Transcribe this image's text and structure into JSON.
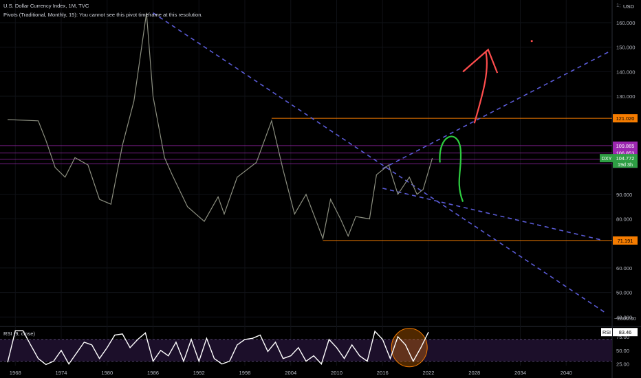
{
  "header": {
    "title": "U.S. Dollar Currency Index, 1M, TVC",
    "pivots_note": "Pivots (Traditional, Monthly, 15): You cannot see this pivot timeframe at this resolution.",
    "currency": "USD",
    "menu_glyph": "1;"
  },
  "rsi_panel": {
    "label": "RSI (9, close)",
    "value_label": "RSI",
    "value": "83.46"
  },
  "chart_data": [
    {
      "type": "line",
      "title": "U.S. Dollar Currency Index, 1M, TVC",
      "symbol": "DXY",
      "x_range": [
        1966,
        2046
      ],
      "y_range": [
        37,
        167
      ],
      "x_ticks": [
        "1968",
        "1974",
        "1980",
        "1986",
        "1992",
        "1998",
        "2004",
        "2010",
        "2016",
        "2022",
        "2028",
        "2034",
        "2040"
      ],
      "y_ticks": [
        "160.000",
        "150.000",
        "140.000",
        "130.000",
        "90.000",
        "80.000",
        "60.000",
        "50.000",
        "40.000"
      ],
      "y_extra_tick": "−2000.00",
      "series_color": "#8c8f80",
      "x": [
        1967,
        1971,
        1972,
        1973.2,
        1974.5,
        1975.8,
        1977.5,
        1979,
        1980.5,
        1982,
        1983.5,
        1985.15,
        1986,
        1987.5,
        1988.5,
        1990.5,
        1992.7,
        1994.5,
        1995.3,
        1997,
        1999.5,
        2001.5,
        2003,
        2004.5,
        2006,
        2008.2,
        2009.2,
        2010.5,
        2011.5,
        2012.5,
        2014.3,
        2015.2,
        2016.8,
        2018,
        2019.5,
        2020.5,
        2021.3,
        2022.5
      ],
      "y": [
        120.5,
        120,
        112,
        101,
        97,
        105,
        102,
        88,
        86,
        110,
        128,
        164,
        130,
        105,
        98,
        85,
        79,
        89,
        82,
        97,
        103,
        120,
        100,
        82,
        90,
        72,
        88,
        80,
        73,
        81,
        80,
        98,
        102,
        90,
        97,
        90,
        92,
        104.772
      ],
      "levels": [
        {
          "label": "109.865",
          "value": 109.865,
          "color": "#9c27b0"
        },
        {
          "label": "106.853",
          "value": 106.853,
          "color": "#9c27b0"
        },
        {
          "label": "104.343",
          "value": 104.343,
          "color": "#9c27b0"
        },
        {
          "label": "102.503",
          "value": 102.503,
          "color": "#9c27b0"
        },
        {
          "label": "121.020",
          "value": 121.02,
          "color": "#f57c00"
        },
        {
          "label": "71.191",
          "value": 71.191,
          "color": "#f57c00"
        }
      ],
      "price_tag": {
        "symbol": "DXY",
        "value": "104.772",
        "countdown": "19d 3h",
        "color": "#2e9e44"
      },
      "trendlines": [
        {
          "x": [
            1986,
            2045
          ],
          "y": [
            164,
            42
          ],
          "style": "dashed",
          "color": "#5a5bd6"
        },
        {
          "x": [
            2016,
            2044.5
          ],
          "y": [
            92.5,
            71.5
          ],
          "style": "dashed",
          "color": "#5a5bd6"
        },
        {
          "x": [
            2016,
            2045.5
          ],
          "y": [
            100.5,
            148
          ],
          "style": "dashed",
          "color": "#5a5bd6"
        }
      ],
      "drawings": [
        {
          "name": "red-up-arrow",
          "color": "#ff4d4d"
        },
        {
          "name": "green-curve",
          "color": "#2ecc40"
        },
        {
          "name": "red-dot",
          "color": "#ff4d4d"
        }
      ]
    },
    {
      "type": "line",
      "title": "RSI (9, close)",
      "x_range": [
        1966,
        2046
      ],
      "y_range": [
        22,
        90
      ],
      "y_ticks": [
        "75.00",
        "50.00",
        "25.00"
      ],
      "band": [
        30,
        70
      ],
      "series_color": "#ffffff",
      "current_value": "83.46",
      "x": [
        1967,
        1968,
        1969,
        1970,
        1971,
        1972,
        1973,
        1974,
        1975,
        1976,
        1977,
        1978,
        1979,
        1980,
        1981,
        1982,
        1983,
        1984,
        1985,
        1986,
        1987,
        1988,
        1989,
        1990,
        1991,
        1992,
        1993,
        1994,
        1995,
        1996,
        1997,
        1998,
        1999,
        2000,
        2001,
        2002,
        2003,
        2004,
        2005,
        2006,
        2007,
        2008,
        2009,
        2010,
        2011,
        2012,
        2013,
        2014,
        2015,
        2016,
        2017,
        2018,
        2019,
        2020,
        2021,
        2022
      ],
      "y": [
        28,
        86,
        86,
        60,
        35,
        24,
        30,
        50,
        25,
        45,
        65,
        60,
        35,
        55,
        78,
        80,
        55,
        70,
        82,
        30,
        50,
        40,
        65,
        30,
        70,
        30,
        72,
        35,
        25,
        30,
        60,
        70,
        72,
        78,
        48,
        65,
        35,
        40,
        55,
        30,
        40,
        25,
        70,
        55,
        35,
        60,
        40,
        30,
        85,
        70,
        35,
        75,
        60,
        30,
        55,
        83.46
      ],
      "highlight": {
        "x": 2019.5,
        "y": 55,
        "color": "#f57c00"
      }
    }
  ]
}
